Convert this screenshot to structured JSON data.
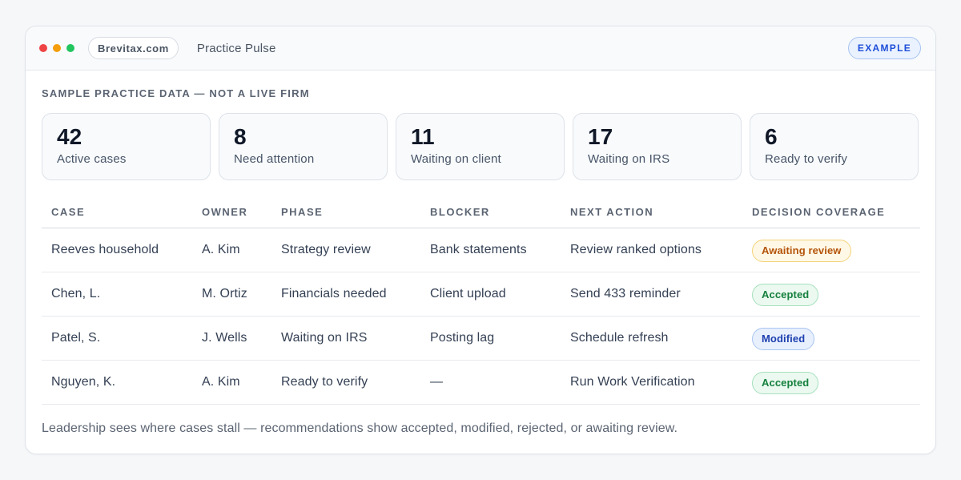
{
  "window": {
    "controls": [
      {
        "name": "close",
        "color": "#ef4444"
      },
      {
        "name": "minimize",
        "color": "#f59e0b"
      },
      {
        "name": "maximize",
        "color": "#22c55e"
      }
    ],
    "url": "Brevitax.com",
    "title": "Practice Pulse",
    "badge": "EXAMPLE"
  },
  "section_label": "SAMPLE PRACTICE DATA — NOT A LIVE FIRM",
  "stats": [
    {
      "value": "42",
      "label": "Active cases"
    },
    {
      "value": "8",
      "label": "Need attention"
    },
    {
      "value": "11",
      "label": "Waiting on client"
    },
    {
      "value": "17",
      "label": "Waiting on IRS"
    },
    {
      "value": "6",
      "label": "Ready to verify"
    }
  ],
  "table": {
    "headers": [
      "CASE",
      "OWNER",
      "PHASE",
      "BLOCKER",
      "NEXT ACTION",
      "DECISION COVERAGE"
    ],
    "rows": [
      {
        "case": "Reeves household",
        "owner": "A. Kim",
        "phase": "Strategy review",
        "blocker": "Bank statements",
        "next_action": "Review ranked options",
        "coverage": "Awaiting review",
        "coverage_status": "awaiting"
      },
      {
        "case": "Chen, L.",
        "owner": "M. Ortiz",
        "phase": "Financials needed",
        "blocker": "Client upload",
        "next_action": "Send 433 reminder",
        "coverage": "Accepted",
        "coverage_status": "accepted"
      },
      {
        "case": "Patel, S.",
        "owner": "J. Wells",
        "phase": "Waiting on IRS",
        "blocker": "Posting lag",
        "next_action": "Schedule refresh",
        "coverage": "Modified",
        "coverage_status": "modified"
      },
      {
        "case": "Nguyen, K.",
        "owner": "A. Kim",
        "phase": "Ready to verify",
        "blocker": "—",
        "next_action": "Run Work Verification",
        "coverage": "Accepted",
        "coverage_status": "accepted"
      }
    ]
  },
  "footer_note": "Leadership sees where cases stall — recommendations show accepted, modified, rejected, or awaiting review.",
  "colors": {
    "awaiting": "#b45309",
    "accepted": "#15803d",
    "modified": "#1e40af",
    "example_accent": "#1d4ed8"
  }
}
